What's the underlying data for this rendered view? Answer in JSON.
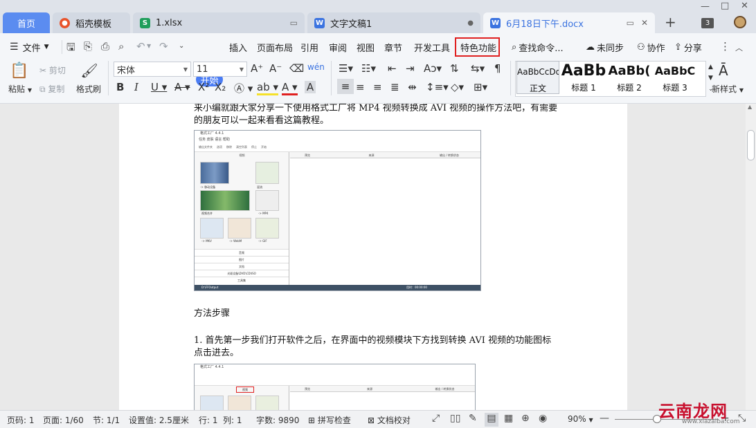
{
  "tabs": {
    "home": "首页",
    "items": [
      {
        "label": "稻壳模板",
        "icon": "docer-icon",
        "color": "#e8532b"
      },
      {
        "label": "1.xlsx",
        "icon": "spreadsheet-icon",
        "color": "#1f9e5b"
      },
      {
        "label": "文字文稿1",
        "icon": "writer-icon",
        "color": "#3b73e0"
      },
      {
        "label": "6月18日下午.docx",
        "icon": "writer-icon",
        "color": "#3b73e0"
      }
    ],
    "badge": "3"
  },
  "menu": {
    "file": "文件",
    "items": [
      "开始",
      "插入",
      "页面布局",
      "引用",
      "审阅",
      "视图",
      "章节",
      "开发工具",
      "特色功能"
    ],
    "search": "查找命令...",
    "sync": "未同步",
    "collab": "协作",
    "share": "分享"
  },
  "ribbon": {
    "paste": "粘贴",
    "cut": "剪切",
    "copy": "复制",
    "format_painter": "格式刷",
    "font_name": "宋体",
    "font_size": "11",
    "new_style": "新样式",
    "styles": [
      {
        "preview": "AaBbCcDd",
        "name": "正文"
      },
      {
        "preview": "AaBb",
        "name": "标题 1"
      },
      {
        "preview": "AaBb(",
        "name": "标题 2"
      },
      {
        "preview": "AaBbC",
        "name": "标题 3"
      }
    ]
  },
  "document": {
    "p1_line1": "来小编就跟大家分享一下使用格式工厂将 MP4 视频转换成 AVI 视频的操作方法吧，有需要",
    "p1_line2": "的朋友可以一起来看看这篇教程。",
    "heading": "方法步骤",
    "step1_line1": "1. 首先第一步我们打开软件之后，在界面中的视频模块下方找到转换 AVI 视频的功能图标",
    "step1_line2": "点击进去。",
    "shot1": {
      "title": "格式工厂 4.4.1",
      "menu": [
        "任务",
        "皮肤",
        "语言",
        "帮助"
      ],
      "toolbar": [
        "输出文件夹",
        "选项",
        "移除",
        "清空列表",
        "停止",
        "开始"
      ],
      "module": "视频",
      "columns": [
        "预览",
        "来源",
        "输出 / 转换状态"
      ],
      "tiles": [
        "-> 移动设备",
        "混流",
        "视频合并",
        "-> MP4",
        "-> MKV",
        "-> WebM",
        "-> GIF"
      ],
      "categories": [
        "音频",
        "图片",
        "文档",
        "光驱设备\\DVD\\CD\\ISO",
        "工具集"
      ],
      "status_left": "D:\\FFOutput",
      "status_right": "用时：00:00:00"
    },
    "shot2": {
      "title": "格式工厂 4.4.1",
      "module": "视频",
      "columns": [
        "预览",
        "来源",
        "输出 / 转换状态"
      ]
    }
  },
  "status": {
    "page_num": "页码: 1",
    "pages": "页面: 1/60",
    "section": "节: 1/1",
    "setting": "设置值: 2.5厘米",
    "row": "行: 1",
    "col": "列: 1",
    "words": "字数: 9890",
    "spell": "拼写检查",
    "proof": "文档校对",
    "zoom": "90%"
  },
  "watermark": {
    "text": "云南龙网",
    "sub": "www.xiazaiba.com"
  },
  "colors": {
    "accent": "#4a7cf4",
    "highlight_box": "#e02020",
    "watermark": "#c8102e"
  }
}
